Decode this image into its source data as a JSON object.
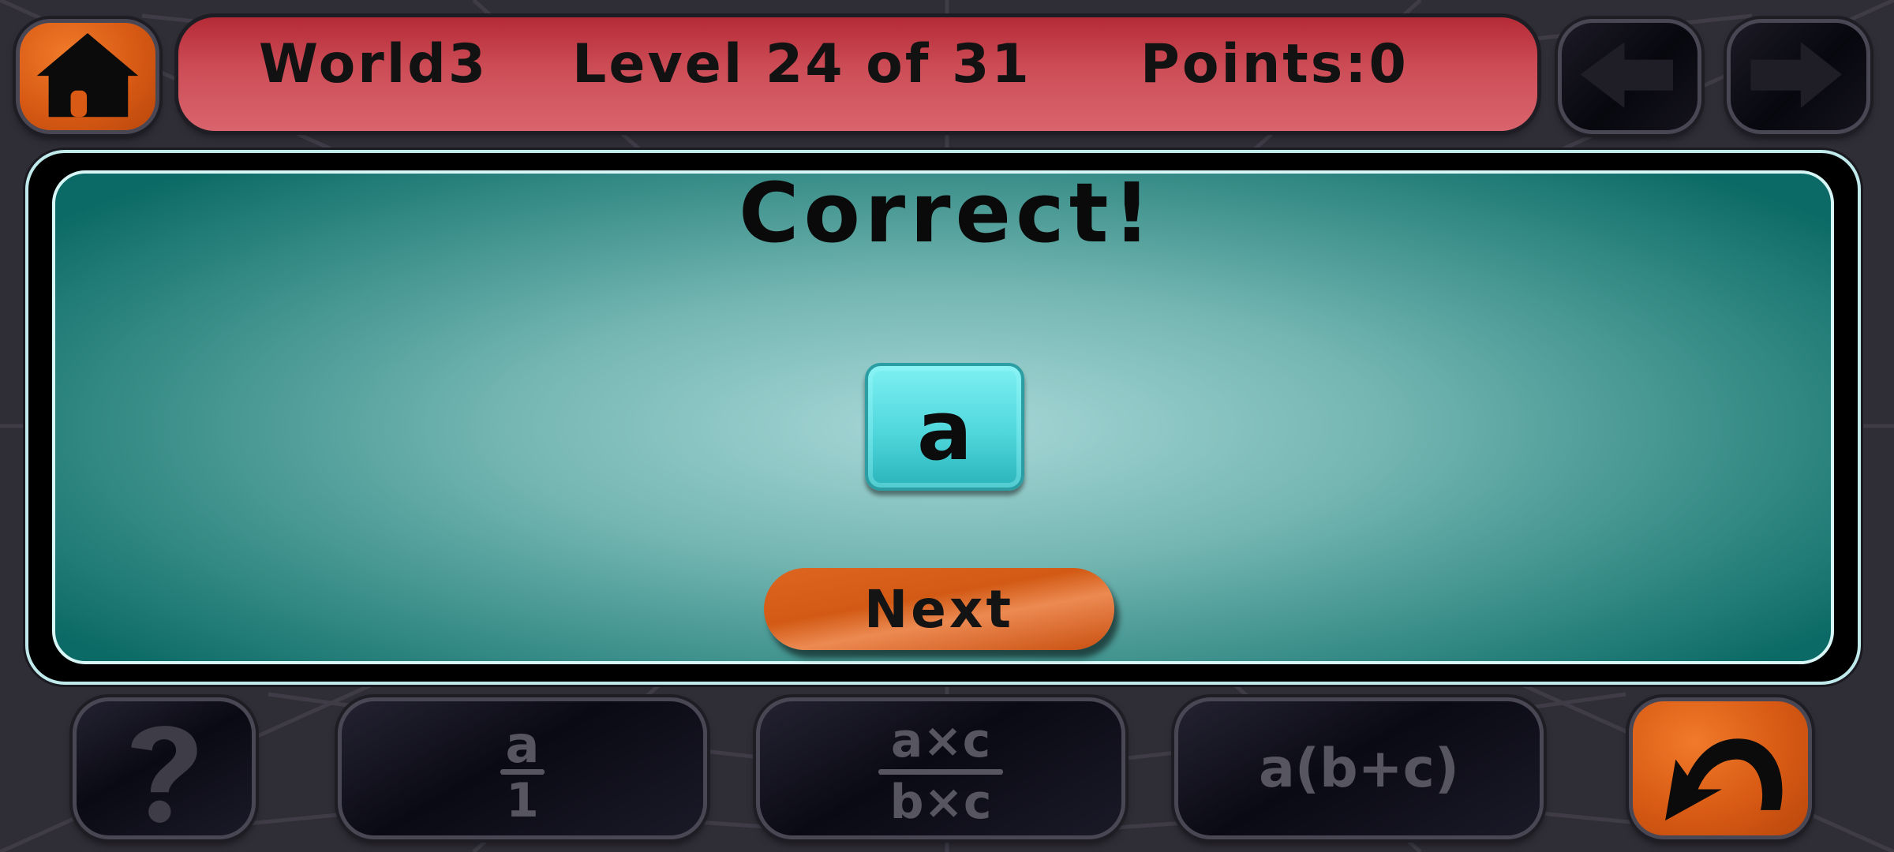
{
  "header": {
    "world": "World3",
    "level": "Level 24 of 31",
    "points": "Points:0"
  },
  "nav": {
    "home_icon": "home-icon",
    "back_icon": "arrow-left-icon",
    "forward_icon": "arrow-right-icon"
  },
  "panel": {
    "title": "Correct!",
    "answer_tile": "a",
    "next_label": "Next"
  },
  "toolbar": {
    "hint_icon": "question-mark-icon",
    "tool1": {
      "numerator": "a",
      "denominator": "1"
    },
    "tool2": {
      "numerator": "a×c",
      "denominator": "b×c"
    },
    "tool3": {
      "label": "a(b+c)"
    },
    "undo_icon": "undo-arrow-icon"
  },
  "colors": {
    "background": "#2f2d35",
    "header_red": "#cd4d57",
    "accent_orange": "#d85a14",
    "panel_teal": "#3e918c",
    "tile_cyan": "#4fd7dc"
  }
}
